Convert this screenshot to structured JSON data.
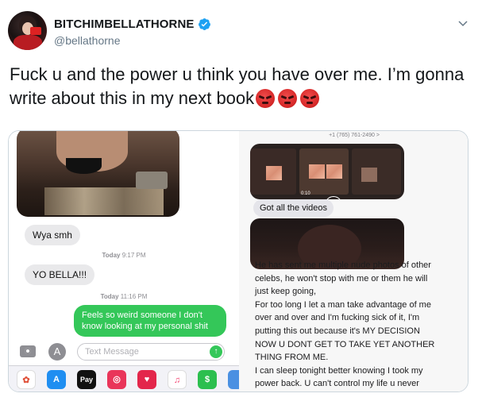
{
  "tweet": {
    "display_name": "BITCHIMBELLATHORNE",
    "handle": "@bellathorne",
    "text": "Fuck u and the power u think you have over me. I’m gonna write about this in my next book",
    "emojis": [
      "angry-face",
      "angry-face",
      "angry-face"
    ],
    "colors": {
      "text": "#14171a",
      "secondary": "#657786",
      "verified": "#1da1f2"
    }
  },
  "left_screenshot": {
    "bubble_1": "Wya smh",
    "timestamp_1_day": "Today",
    "timestamp_1_time": "9:17 PM",
    "bubble_2": "YO BELLA!!!",
    "timestamp_2_day": "Today",
    "timestamp_2_time": "11:16 PM",
    "bubble_3_line1": "Feels so weird someone I don't",
    "bubble_3_line2": "know looking at my personal shit",
    "compose_placeholder": "Text Message",
    "dock_apple_pay": "Pay",
    "colors": {
      "imessage_green": "#34c759",
      "bubble_grey": "#e9e9eb"
    }
  },
  "right_screenshot": {
    "contact": "+1 (765) 761-2490 >",
    "video_time": "0:10",
    "bubble_1": "Got all the videos",
    "note_lines": [
      "He has sent me multiple nude photos of other",
      "celebs, he won't stop with me or them he will",
      "just keep going,",
      "For too long I let a man take advantage of me",
      "over and over and I'm fucking sick of it, I'm",
      "putting this out because it's MY DECISION",
      "NOW U DONT GET TO TAKE YET ANOTHER",
      "THING FROM ME.",
      "I can sleep tonight better knowing I took my",
      "power back. U can't control my life u never"
    ]
  }
}
